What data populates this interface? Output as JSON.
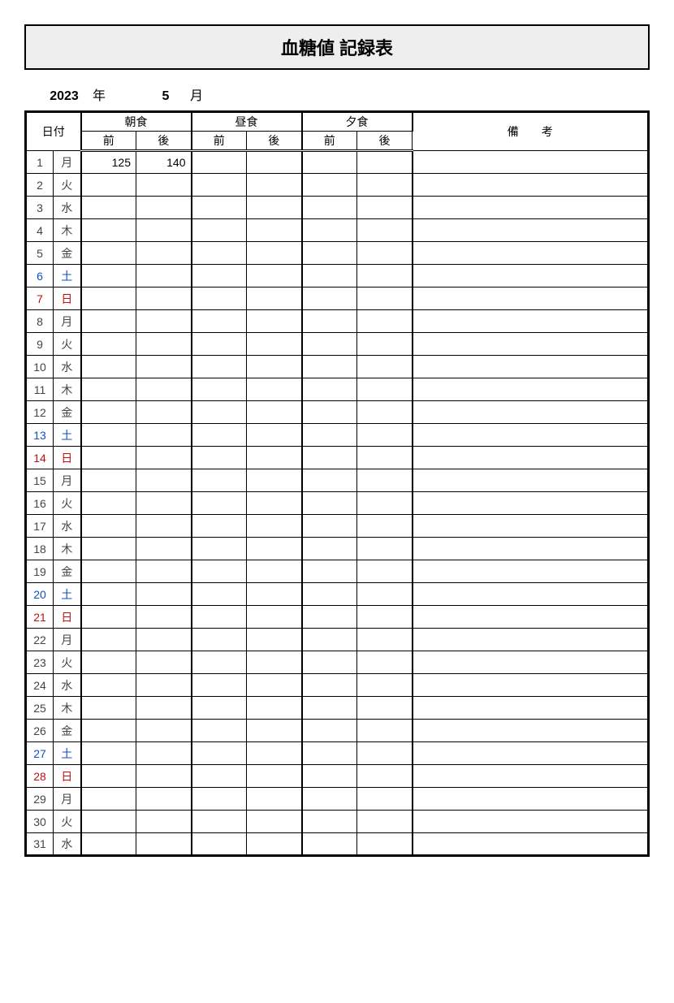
{
  "title": "血糖値 記録表",
  "year": "2023",
  "year_label": "年",
  "month": "5",
  "month_label": "月",
  "headers": {
    "date": "日付",
    "breakfast": "朝食",
    "lunch": "昼食",
    "dinner": "夕食",
    "notes": "備　　考",
    "before": "前",
    "after": "後"
  },
  "rows": [
    {
      "day": "1",
      "dow": "月",
      "cls": "",
      "bf_b": "125",
      "bf_a": "140",
      "lu_b": "",
      "lu_a": "",
      "di_b": "",
      "di_a": "",
      "notes": ""
    },
    {
      "day": "2",
      "dow": "火",
      "cls": "",
      "bf_b": "",
      "bf_a": "",
      "lu_b": "",
      "lu_a": "",
      "di_b": "",
      "di_a": "",
      "notes": ""
    },
    {
      "day": "3",
      "dow": "水",
      "cls": "",
      "bf_b": "",
      "bf_a": "",
      "lu_b": "",
      "lu_a": "",
      "di_b": "",
      "di_a": "",
      "notes": ""
    },
    {
      "day": "4",
      "dow": "木",
      "cls": "",
      "bf_b": "",
      "bf_a": "",
      "lu_b": "",
      "lu_a": "",
      "di_b": "",
      "di_a": "",
      "notes": ""
    },
    {
      "day": "5",
      "dow": "金",
      "cls": "",
      "bf_b": "",
      "bf_a": "",
      "lu_b": "",
      "lu_a": "",
      "di_b": "",
      "di_a": "",
      "notes": ""
    },
    {
      "day": "6",
      "dow": "土",
      "cls": "sat",
      "bf_b": "",
      "bf_a": "",
      "lu_b": "",
      "lu_a": "",
      "di_b": "",
      "di_a": "",
      "notes": ""
    },
    {
      "day": "7",
      "dow": "日",
      "cls": "sun",
      "bf_b": "",
      "bf_a": "",
      "lu_b": "",
      "lu_a": "",
      "di_b": "",
      "di_a": "",
      "notes": ""
    },
    {
      "day": "8",
      "dow": "月",
      "cls": "",
      "bf_b": "",
      "bf_a": "",
      "lu_b": "",
      "lu_a": "",
      "di_b": "",
      "di_a": "",
      "notes": ""
    },
    {
      "day": "9",
      "dow": "火",
      "cls": "",
      "bf_b": "",
      "bf_a": "",
      "lu_b": "",
      "lu_a": "",
      "di_b": "",
      "di_a": "",
      "notes": ""
    },
    {
      "day": "10",
      "dow": "水",
      "cls": "",
      "bf_b": "",
      "bf_a": "",
      "lu_b": "",
      "lu_a": "",
      "di_b": "",
      "di_a": "",
      "notes": ""
    },
    {
      "day": "11",
      "dow": "木",
      "cls": "",
      "bf_b": "",
      "bf_a": "",
      "lu_b": "",
      "lu_a": "",
      "di_b": "",
      "di_a": "",
      "notes": ""
    },
    {
      "day": "12",
      "dow": "金",
      "cls": "",
      "bf_b": "",
      "bf_a": "",
      "lu_b": "",
      "lu_a": "",
      "di_b": "",
      "di_a": "",
      "notes": ""
    },
    {
      "day": "13",
      "dow": "土",
      "cls": "sat",
      "bf_b": "",
      "bf_a": "",
      "lu_b": "",
      "lu_a": "",
      "di_b": "",
      "di_a": "",
      "notes": ""
    },
    {
      "day": "14",
      "dow": "日",
      "cls": "sun",
      "bf_b": "",
      "bf_a": "",
      "lu_b": "",
      "lu_a": "",
      "di_b": "",
      "di_a": "",
      "notes": ""
    },
    {
      "day": "15",
      "dow": "月",
      "cls": "",
      "bf_b": "",
      "bf_a": "",
      "lu_b": "",
      "lu_a": "",
      "di_b": "",
      "di_a": "",
      "notes": ""
    },
    {
      "day": "16",
      "dow": "火",
      "cls": "",
      "bf_b": "",
      "bf_a": "",
      "lu_b": "",
      "lu_a": "",
      "di_b": "",
      "di_a": "",
      "notes": ""
    },
    {
      "day": "17",
      "dow": "水",
      "cls": "",
      "bf_b": "",
      "bf_a": "",
      "lu_b": "",
      "lu_a": "",
      "di_b": "",
      "di_a": "",
      "notes": ""
    },
    {
      "day": "18",
      "dow": "木",
      "cls": "",
      "bf_b": "",
      "bf_a": "",
      "lu_b": "",
      "lu_a": "",
      "di_b": "",
      "di_a": "",
      "notes": ""
    },
    {
      "day": "19",
      "dow": "金",
      "cls": "",
      "bf_b": "",
      "bf_a": "",
      "lu_b": "",
      "lu_a": "",
      "di_b": "",
      "di_a": "",
      "notes": ""
    },
    {
      "day": "20",
      "dow": "土",
      "cls": "sat",
      "bf_b": "",
      "bf_a": "",
      "lu_b": "",
      "lu_a": "",
      "di_b": "",
      "di_a": "",
      "notes": ""
    },
    {
      "day": "21",
      "dow": "日",
      "cls": "sun",
      "bf_b": "",
      "bf_a": "",
      "lu_b": "",
      "lu_a": "",
      "di_b": "",
      "di_a": "",
      "notes": ""
    },
    {
      "day": "22",
      "dow": "月",
      "cls": "",
      "bf_b": "",
      "bf_a": "",
      "lu_b": "",
      "lu_a": "",
      "di_b": "",
      "di_a": "",
      "notes": ""
    },
    {
      "day": "23",
      "dow": "火",
      "cls": "",
      "bf_b": "",
      "bf_a": "",
      "lu_b": "",
      "lu_a": "",
      "di_b": "",
      "di_a": "",
      "notes": ""
    },
    {
      "day": "24",
      "dow": "水",
      "cls": "",
      "bf_b": "",
      "bf_a": "",
      "lu_b": "",
      "lu_a": "",
      "di_b": "",
      "di_a": "",
      "notes": ""
    },
    {
      "day": "25",
      "dow": "木",
      "cls": "",
      "bf_b": "",
      "bf_a": "",
      "lu_b": "",
      "lu_a": "",
      "di_b": "",
      "di_a": "",
      "notes": ""
    },
    {
      "day": "26",
      "dow": "金",
      "cls": "",
      "bf_b": "",
      "bf_a": "",
      "lu_b": "",
      "lu_a": "",
      "di_b": "",
      "di_a": "",
      "notes": ""
    },
    {
      "day": "27",
      "dow": "土",
      "cls": "sat",
      "bf_b": "",
      "bf_a": "",
      "lu_b": "",
      "lu_a": "",
      "di_b": "",
      "di_a": "",
      "notes": ""
    },
    {
      "day": "28",
      "dow": "日",
      "cls": "sun",
      "bf_b": "",
      "bf_a": "",
      "lu_b": "",
      "lu_a": "",
      "di_b": "",
      "di_a": "",
      "notes": ""
    },
    {
      "day": "29",
      "dow": "月",
      "cls": "",
      "bf_b": "",
      "bf_a": "",
      "lu_b": "",
      "lu_a": "",
      "di_b": "",
      "di_a": "",
      "notes": ""
    },
    {
      "day": "30",
      "dow": "火",
      "cls": "",
      "bf_b": "",
      "bf_a": "",
      "lu_b": "",
      "lu_a": "",
      "di_b": "",
      "di_a": "",
      "notes": ""
    },
    {
      "day": "31",
      "dow": "水",
      "cls": "",
      "bf_b": "",
      "bf_a": "",
      "lu_b": "",
      "lu_a": "",
      "di_b": "",
      "di_a": "",
      "notes": ""
    }
  ]
}
